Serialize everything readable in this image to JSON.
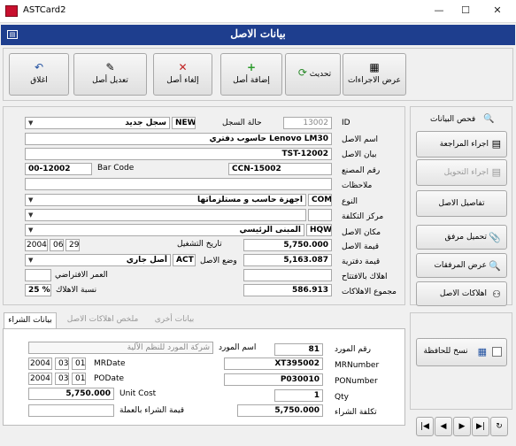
{
  "window": {
    "title": "ASTCard2",
    "minimize": "—",
    "maximize": "☐",
    "close": "✕"
  },
  "form": {
    "title": "بيانات الاصل",
    "icon": "form-grid-icon"
  },
  "toolbar": {
    "procedures": {
      "label": "عرض الاجراءات",
      "icon": "grid-icon"
    },
    "update": {
      "label": "تحديث",
      "icon": "refresh-icon"
    },
    "add": {
      "label": "إضافة أصل",
      "icon": "plus-icon"
    },
    "cancel": {
      "label": "إلغاء أصل",
      "icon": "x-icon"
    },
    "edit": {
      "label": "تعديل أصل",
      "icon": "pencil-icon"
    },
    "close": {
      "label": "اغلاق",
      "icon": "undo-icon"
    }
  },
  "side": {
    "check_label": "فحص البيانات",
    "review": "اجراء المراجعة",
    "transfer": "اجراء التحويل",
    "details": "تفاصيل الاصل",
    "upload": "تحميل مرفق",
    "view_attach": "عرض المرفقات",
    "depreciation": "اهلاكات الاصل",
    "copy_clipboard": "نسخ للحافظة"
  },
  "fields": {
    "id": {
      "label": "ID",
      "value": "13002"
    },
    "record_status": {
      "label": "حالة السجل",
      "code": "NEW",
      "value": "سجل جديد"
    },
    "asset_name": {
      "label": "اسم الاصل",
      "value": "حاسوب دفتري Lenovo LM30"
    },
    "asset_desc": {
      "label": "بيان الاصل",
      "value": "TST-12002"
    },
    "factory_no": {
      "label": "رقم المصنع",
      "value": "CCN-15002"
    },
    "barcode": {
      "label": "Bar Code",
      "value": "00-12002"
    },
    "notes": {
      "label": "ملاحظات",
      "value": ""
    },
    "type": {
      "label": "النوع",
      "code": "COM",
      "value": "اجهزة حاسب و مستلزماتها"
    },
    "cost_center": {
      "label": "مركز التكلفة",
      "code": "",
      "value": ""
    },
    "location": {
      "label": "مكان الاصل",
      "code": "HQW",
      "value": "المبنى الرئيسي"
    },
    "asset_value": {
      "label": "قيمة الاصل",
      "value": "5,750.000"
    },
    "op_date": {
      "label": "تاريخ التشغيل",
      "d": "29",
      "m": "06",
      "y": "2004"
    },
    "book_value": {
      "label": "قيمة دفترية",
      "value": "5,163.087"
    },
    "asset_status": {
      "label": "وضع الاصل",
      "code": "ACT",
      "value": "أصل جاري"
    },
    "opening_dep": {
      "label": "اهلاك بالافتتاح",
      "value": ""
    },
    "default_age": {
      "label": "العمر الافتراضي",
      "value": ""
    },
    "total_dep": {
      "label": "مجموع الاهلاكات",
      "value": "586.913"
    },
    "dep_rate": {
      "label": "نسبة الاهلاك",
      "value": "25 %"
    }
  },
  "tabs": {
    "purchase": "بيانات الشراء",
    "dep_summary": "ملخص اهلاكات الاصل",
    "other": "بيانات أخرى"
  },
  "purchase": {
    "supplier_no": {
      "label": "رقم المورد",
      "value": "81"
    },
    "supplier_name": {
      "label": "اسم المورد",
      "value": "شركة المورد للنظم الآلية"
    },
    "mr_number": {
      "label": "MRNumber",
      "value": "XT395002"
    },
    "mr_date": {
      "label": "MRDate",
      "d": "01",
      "m": "03",
      "y": "2004"
    },
    "po_number": {
      "label": "PONumber",
      "value": "P030010"
    },
    "po_date": {
      "label": "PODate",
      "d": "01",
      "m": "03",
      "y": "2004"
    },
    "qty": {
      "label": "Qty",
      "value": "1"
    },
    "unit_cost": {
      "label": "Unit Cost",
      "value": "5,750.000"
    },
    "purchase_cost": {
      "label": "تكلفة الشراء",
      "value": "5,750.000"
    },
    "purchase_value_currency": {
      "label": "قيمة الشراء بالعملة",
      "value": ""
    }
  },
  "nav": {
    "first": "|◀",
    "prev": "◀",
    "next": "▶",
    "last": "▶|",
    "refresh": "↻"
  }
}
